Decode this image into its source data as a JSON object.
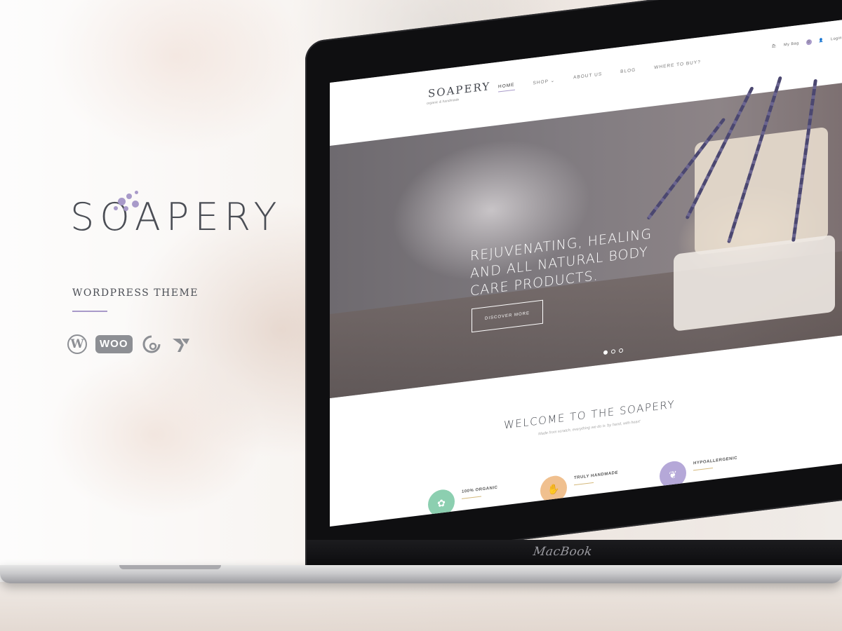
{
  "brand": {
    "name": "SOAPERY",
    "tagline": "WORDPRESS THEME",
    "accent_color": "#a89ac9",
    "badges": [
      {
        "name": "wordpress-icon",
        "label": "W"
      },
      {
        "name": "woocommerce-badge",
        "label": "WOO"
      },
      {
        "name": "revolution-slider-icon",
        "label": ""
      },
      {
        "name": "visual-composer-icon",
        "label": ""
      }
    ]
  },
  "device": {
    "label": "MacBook"
  },
  "site": {
    "logo": "SOAPERY",
    "logo_sub": "organic & handmade",
    "menu": [
      {
        "label": "Home",
        "active": true
      },
      {
        "label": "Shop ⌄",
        "active": false
      },
      {
        "label": "About us",
        "active": false
      },
      {
        "label": "Blog",
        "active": false
      },
      {
        "label": "Where to buy?",
        "active": false
      }
    ],
    "bag_label": "My Bag",
    "bag_count": "0",
    "login_label": "Login",
    "hero": {
      "headline": "Rejuvenating, healing and all natural body care products.",
      "button": "DISCOVER MORE",
      "slides": 3,
      "active_slide": 1
    },
    "welcome": {
      "title": "WELCOME TO THE SOAPERY",
      "subtitle": "Made from scratch, everything we do is 'by hand, with heart'"
    },
    "features": [
      {
        "title": "100% ORGANIC",
        "color": "#8ccfb0",
        "icon": "leaf-icon"
      },
      {
        "title": "TRULY HANDMADE",
        "color": "#f0c08f",
        "icon": "hand-icon"
      },
      {
        "title": "HYPOALLERGENIC",
        "color": "#b5a8d8",
        "icon": "feather-icon"
      }
    ]
  }
}
